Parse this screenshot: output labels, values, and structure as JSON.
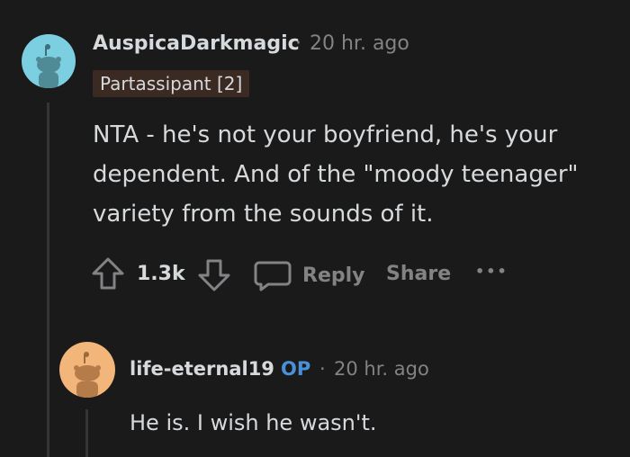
{
  "comment1": {
    "username": "AuspicaDarkmagic",
    "separator": "·",
    "time": "20 hr. ago",
    "flair": "Partassipant [2]",
    "body_lines": [
      "NTA - he's not your boyfriend, he's your",
      "dependent. And of the \"moody teenager\"",
      "variety from the sounds of it."
    ],
    "votes": "1.3k",
    "reply_label": "Reply",
    "share_label": "Share",
    "more_label": "•••",
    "avatar_color": "#7bcfe0"
  },
  "comment2": {
    "username": "life-eternal19",
    "op_badge": "OP",
    "separator": "·",
    "time": "20 hr. ago",
    "body": "He is. I wish he wasn't.",
    "avatar_color": "#f2b57a"
  },
  "colors": {
    "background": "#1a1a1b",
    "text": "#d7dadc",
    "muted": "#818384",
    "op_blue": "#4a90d9",
    "flair_bg": "#3a2a22"
  }
}
